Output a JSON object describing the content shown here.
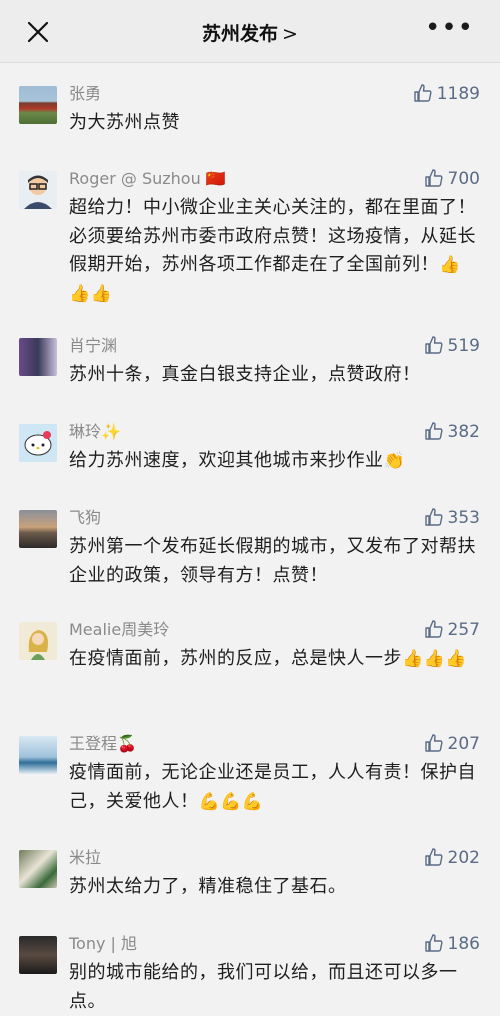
{
  "header": {
    "title": "苏州发布",
    "chevron": ">"
  },
  "comments": [
    {
      "name": "张勇",
      "likes": "1189",
      "text": "为大苏州点赞"
    },
    {
      "name": "Roger @ Suzhou",
      "badge": "🇨🇳",
      "likes": "700",
      "text": "超给力！中小微企业主关心关注的，都在里面了！必须要给苏州市委市政府点赞！这场疫情，从延长假期开始，苏州各项工作都走在了全国前列！",
      "emoji": "👍👍👍"
    },
    {
      "name": "肖宁渊",
      "likes": "519",
      "text": "苏州十条，真金白银支持企业，点赞政府！"
    },
    {
      "name": "琳玲",
      "badge": "✨",
      "likes": "382",
      "text": "给力苏州速度，欢迎其他城市来抄作业",
      "emoji": "👏"
    },
    {
      "name": "飞狗",
      "likes": "353",
      "text": "苏州第一个发布延长假期的城市，又发布了对帮扶企业的政策，领导有方！点赞！"
    },
    {
      "name": "Mealie周美玲",
      "likes": "257",
      "text": "在疫情面前，苏州的反应，总是快人一步",
      "emoji": "👍👍👍"
    },
    {
      "name": "王登程",
      "badge": "🍒",
      "likes": "207",
      "text": "疫情面前，无论企业还是员工，人人有责！保护自己，关爱他人！",
      "emoji": "💪💪💪"
    },
    {
      "name": "米拉",
      "likes": "202",
      "text": "苏州太给力了，精准稳住了基石。"
    },
    {
      "name": "Tony | 旭",
      "likes": "186",
      "text": "别的城市能给的，我们可以给，而且还可以多一点。"
    }
  ]
}
